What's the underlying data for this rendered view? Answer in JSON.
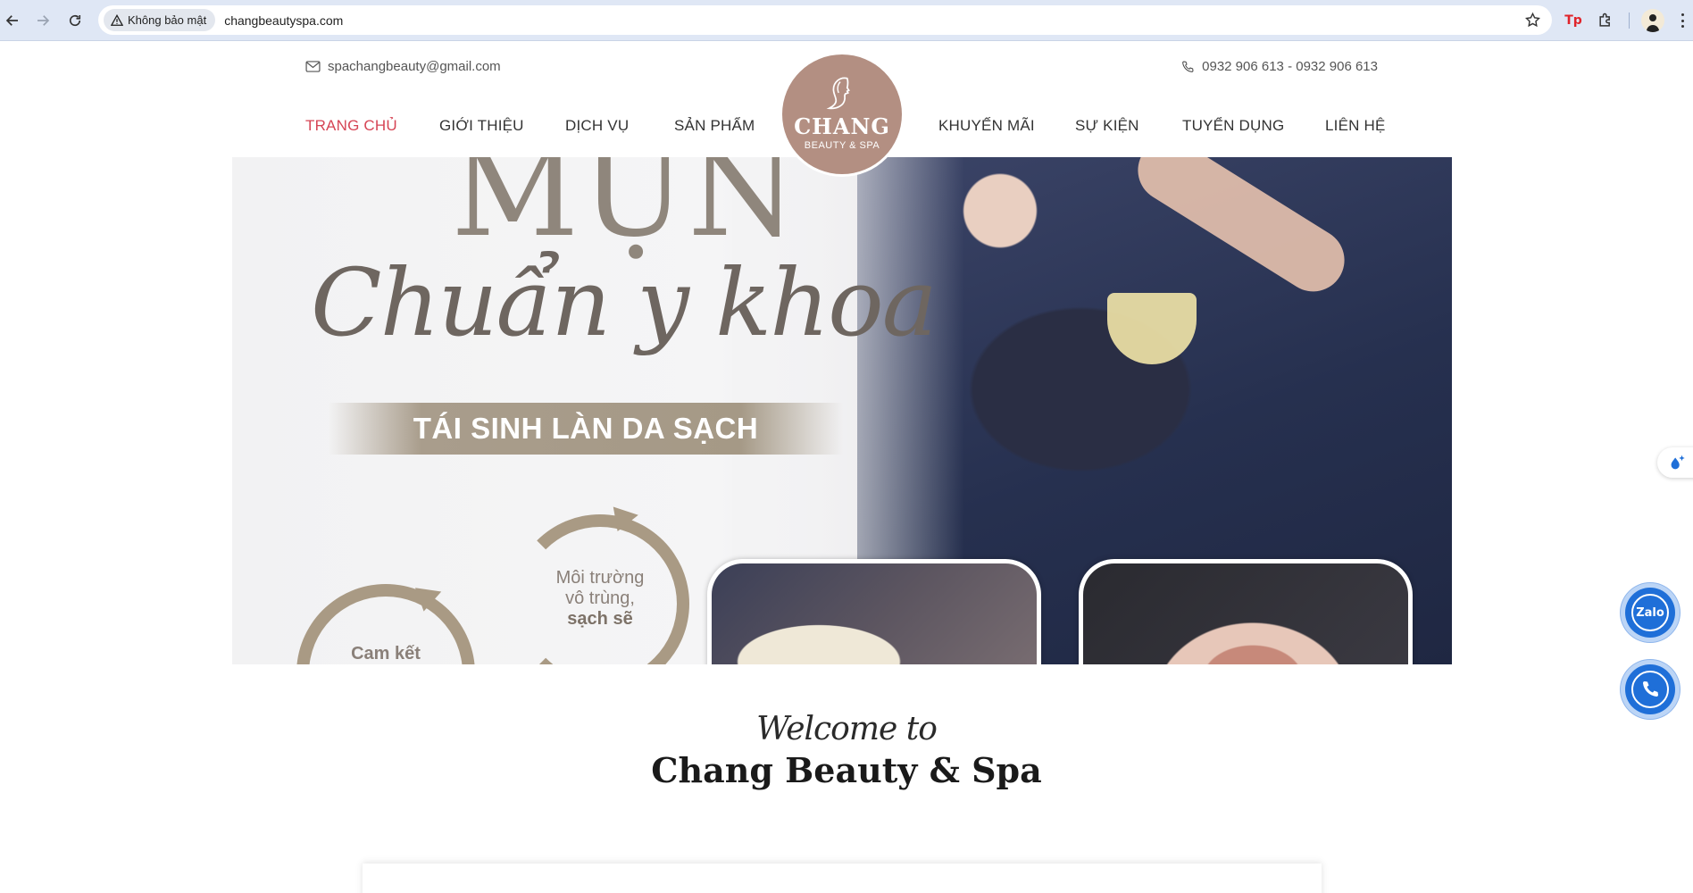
{
  "browser": {
    "security_label": "Không bảo mật",
    "url": "changbeautyspa.com",
    "extension_tp": "Tp"
  },
  "topbar": {
    "email": "spachangbeauty@gmail.com",
    "phone": "0932 906 613 - 0932 906 613"
  },
  "menu": {
    "items": [
      {
        "label": "TRANG CHỦ",
        "active": true
      },
      {
        "label": "GIỚI THIỆU"
      },
      {
        "label": "DỊCH VỤ"
      },
      {
        "label": "SẢN PHẨM"
      },
      {
        "label": "KHUYẾN MÃI"
      },
      {
        "label": "SỰ KIỆN"
      },
      {
        "label": "TUYỂN DỤNG"
      },
      {
        "label": "LIÊN HỆ"
      }
    ],
    "active_color": "#d64555"
  },
  "logo": {
    "name": "CHANG",
    "sub": "BEAUTY & SPA",
    "color": "#b38f82"
  },
  "hero": {
    "headline": "MỤN",
    "script": "Chuẩn y khoa",
    "ribbon": "TÁI SINH LÀN DA SẠCH",
    "ring1_line1": "Môi trường",
    "ring1_line2": "vô trùng,",
    "ring1_bold": "sạch sẽ",
    "ring2_text": "Cam kết"
  },
  "welcome": {
    "script": "Welcome to",
    "title": "Chang Beauty & Spa"
  },
  "floating": {
    "zalo_label": "Zalo",
    "accent": "#1f6fd8"
  }
}
